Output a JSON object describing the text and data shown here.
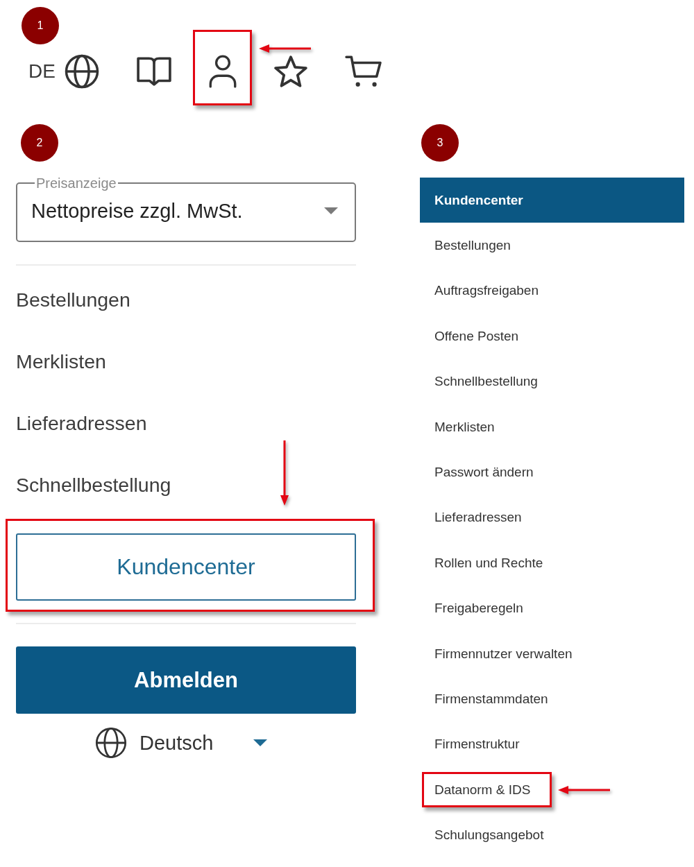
{
  "header_panel": {
    "step": "1",
    "toolbar": [
      {
        "kind": "language",
        "label": "DE",
        "highlighted": false
      },
      {
        "kind": "catalog",
        "highlighted": false
      },
      {
        "kind": "account",
        "highlighted": true
      },
      {
        "kind": "favorites",
        "highlighted": false
      },
      {
        "kind": "cart",
        "highlighted": false
      }
    ]
  },
  "account_menu": {
    "step": "2",
    "price_select": {
      "label": "Preisanzeige",
      "value": "Nettopreise zzgl. MwSt."
    },
    "links": [
      {
        "label": "Bestellungen"
      },
      {
        "label": "Merklisten"
      },
      {
        "label": "Lieferadressen"
      },
      {
        "label": "Schnellbestellung"
      }
    ],
    "customer_center_button": {
      "label": "Kundencenter",
      "highlighted": true
    },
    "logout_button": {
      "label": "Abmelden"
    },
    "language_select": {
      "value": "Deutsch"
    }
  },
  "customer_center_nav": {
    "step": "3",
    "items": [
      {
        "label": "Kundencenter",
        "selected": true,
        "highlighted": false
      },
      {
        "label": "Bestellungen",
        "selected": false,
        "highlighted": false
      },
      {
        "label": "Auftragsfreigaben",
        "selected": false,
        "highlighted": false
      },
      {
        "label": "Offene Posten",
        "selected": false,
        "highlighted": false
      },
      {
        "label": "Schnellbestellung",
        "selected": false,
        "highlighted": false
      },
      {
        "label": "Merklisten",
        "selected": false,
        "highlighted": false
      },
      {
        "label": "Passwort ändern",
        "selected": false,
        "highlighted": false
      },
      {
        "label": "Lieferadressen",
        "selected": false,
        "highlighted": false
      },
      {
        "label": "Rollen und Rechte",
        "selected": false,
        "highlighted": false
      },
      {
        "label": "Freigaberegeln",
        "selected": false,
        "highlighted": false
      },
      {
        "label": "Firmennutzer verwalten",
        "selected": false,
        "highlighted": false
      },
      {
        "label": "Firmenstammdaten",
        "selected": false,
        "highlighted": false
      },
      {
        "label": "Firmenstruktur",
        "selected": false,
        "highlighted": false
      },
      {
        "label": "Datanorm & IDS",
        "selected": false,
        "highlighted": true
      },
      {
        "label": "Schulungsangebot",
        "selected": false,
        "highlighted": false
      }
    ]
  }
}
